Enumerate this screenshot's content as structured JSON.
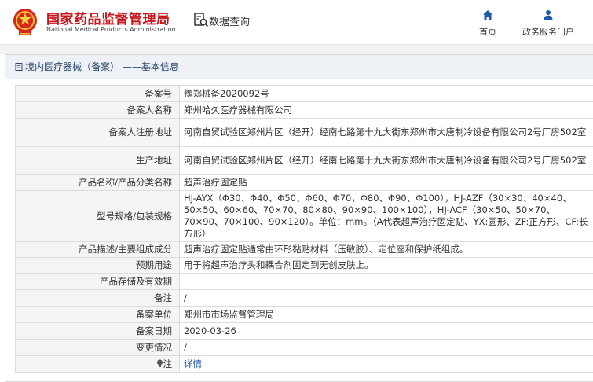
{
  "header": {
    "logo_cn": "国家药品监督管理局",
    "logo_en": "National Medical Products Administration",
    "query_label": "数据查询",
    "nav": [
      {
        "label": "首页",
        "icon": "home-icon"
      },
      {
        "label": "政务服务门户",
        "icon": "user-icon"
      }
    ]
  },
  "panel": {
    "title": "境内医疗器械（备案） ——基本信息"
  },
  "rows": [
    {
      "key": "备案号",
      "value": "豫郑械备2020092号"
    },
    {
      "key": "备案人名称",
      "value": "郑州哈久医疗器械有限公司"
    },
    {
      "key": "备案人注册地址",
      "value": "河南自贸试验区郑州片区（经开）经南七路第十九大街东郑州市大唐制冷设备有限公司2号厂房502室"
    },
    {
      "key": "生产地址",
      "value": "河南自贸试验区郑州片区（经开）经南七路第十九大街东郑州市大唐制冷设备有限公司2号厂房502室"
    },
    {
      "key": "产品名称/产品分类名称",
      "value": "超声治疗固定贴"
    },
    {
      "key": "型号规格/包装规格",
      "value": "HJ-AYX（Φ30、Φ40、Φ50、Φ60、Φ70，Φ80、Φ90、Φ100），HJ-AZF（30×30、40×40、50×50、60×60、70×70、80×80、90×90、100×100），HJ-ACF（30×50、50×70、70×90、70×100、90×120）。单位：mm。（A代表超声治疗固定贴、YX:圆形、ZF:正方形、CF:长方形）"
    },
    {
      "key": "产品描述/主要组成成分",
      "value": "超声治疗固定贴通常由环形黏贴材料（压敏胶）、定位座和保护纸组成。"
    },
    {
      "key": "预期用途",
      "value": "用于将超声治疗头和耦合剂固定到无创皮肤上。"
    },
    {
      "key": "产品存储及有效期",
      "value": ""
    },
    {
      "key": "备注",
      "value": "/"
    },
    {
      "key": "备案单位",
      "value": "郑州市市场监督管理局"
    },
    {
      "key": "备案日期",
      "value": "2020-03-26"
    },
    {
      "key": "变更情况",
      "value": "/"
    },
    {
      "key": "注",
      "value": "详情"
    }
  ],
  "colors": {
    "brand_red": "#c8161d",
    "title_blue": "#2e4a70",
    "link_blue": "#1f5aa8"
  }
}
